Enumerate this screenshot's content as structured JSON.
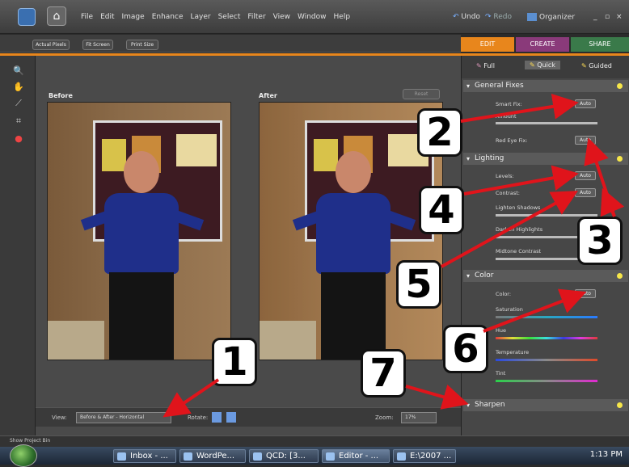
{
  "menubar": {
    "menus": [
      "File",
      "Edit",
      "Image",
      "Enhance",
      "Layer",
      "Select",
      "Filter",
      "View",
      "Window",
      "Help"
    ],
    "undo": "Undo",
    "redo": "Redo",
    "organizer": "Organizer"
  },
  "toolrow": {
    "actual_pixels": "Actual Pixels",
    "fit_screen": "Fit Screen",
    "print_size": "Print Size"
  },
  "mode_tabs": {
    "edit": "EDIT",
    "create": "CREATE",
    "share": "SHARE"
  },
  "sub_tabs": {
    "full": "Full",
    "quick": "Quick",
    "guided": "Guided"
  },
  "canvas": {
    "before": "Before",
    "after": "After",
    "reset": "Reset"
  },
  "bottombar": {
    "view_label": "View:",
    "view_value": "Before & After - Horizontal",
    "rotate_label": "Rotate:",
    "zoom_label": "Zoom:",
    "zoom_value": "17%"
  },
  "panel": {
    "general_fixes": "General Fixes",
    "smart_fix": "Smart Fix:",
    "amount": "Amount",
    "red_eye": "Red Eye Fix:",
    "lighting": "Lighting",
    "levels": "Levels:",
    "contrast": "Contrast:",
    "lighten_shadows": "Lighten Shadows",
    "darken_highlights": "Darken Highlights",
    "midtone_contrast": "Midtone Contrast",
    "color": "Color",
    "color_label": "Color:",
    "saturation": "Saturation",
    "hue": "Hue",
    "temperature": "Temperature",
    "tint": "Tint",
    "sharpen": "Sharpen",
    "auto": "Auto"
  },
  "project_bin": "Show Project Bin",
  "taskbar": {
    "items": [
      "Inbox - ...",
      "WordPe...",
      "QCD: [3...",
      "Editor - ...",
      "E:\\2007 ..."
    ],
    "clock": "1:13 PM"
  },
  "callouts": [
    "1",
    "2",
    "3",
    "4",
    "5",
    "6",
    "7"
  ],
  "colors": {
    "accent": "#e8861c",
    "edit_tab": "#e8861c",
    "create_tab": "#8a3a7a",
    "share_tab": "#3a7a4a",
    "arrow": "#e0141b"
  }
}
